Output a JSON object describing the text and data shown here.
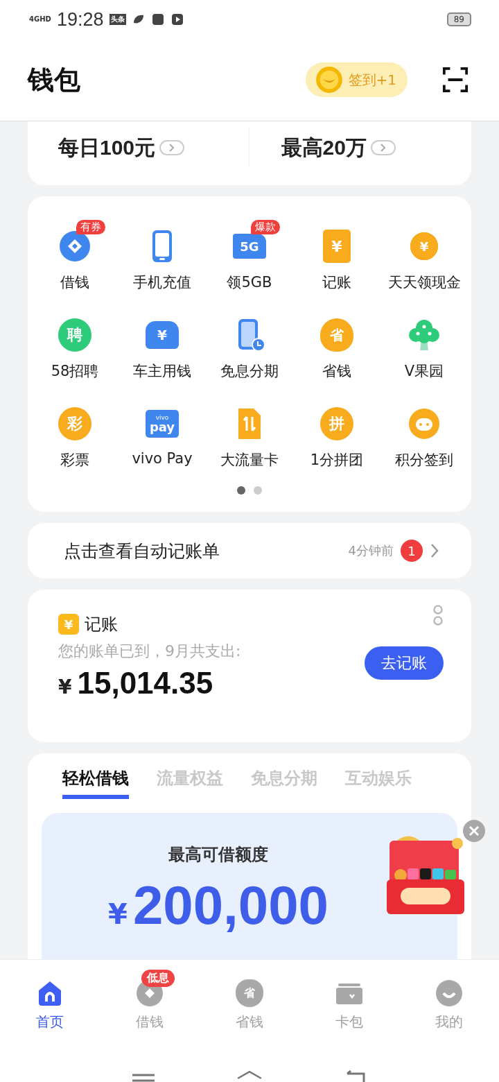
{
  "status_bar": {
    "network": "4GHD",
    "time": "19:28",
    "app_badge": "头条",
    "battery": "89"
  },
  "header": {
    "title": "钱包",
    "checkin": "签到+1"
  },
  "quick_stats": [
    {
      "value": "每日100元"
    },
    {
      "value": "最高20万"
    }
  ],
  "services": [
    {
      "label": "借钱",
      "kind": "coin-diamond",
      "color": "#3f86ee",
      "badge": "有券"
    },
    {
      "label": "手机充值",
      "kind": "phone",
      "color": "#3f86ee"
    },
    {
      "label": "领5GB",
      "kind": "sim",
      "color": "#3f86ee",
      "glyph": "5G",
      "badge": "爆款"
    },
    {
      "label": "记账",
      "kind": "book",
      "color": "#f8ab1c",
      "glyph": "¥"
    },
    {
      "label": "天天领现金",
      "kind": "ring",
      "color": "#f8ab1c",
      "glyph": "¥"
    },
    {
      "label": "58招聘",
      "kind": "circle",
      "color": "#2ecc7a",
      "glyph": "聘"
    },
    {
      "label": "车主用钱",
      "kind": "car",
      "color": "#3f86ee",
      "glyph": "¥"
    },
    {
      "label": "免息分期",
      "kind": "phone-clock",
      "color": "#3f86ee"
    },
    {
      "label": "省钱",
      "kind": "bag",
      "color": "#f8ab1c",
      "glyph": "省"
    },
    {
      "label": "V果园",
      "kind": "tree",
      "color": "#2ecc7a"
    },
    {
      "label": "彩票",
      "kind": "circle",
      "color": "#f8ab1c",
      "glyph": "彩"
    },
    {
      "label": "vivo Pay",
      "kind": "pay",
      "color": "#3f86ee",
      "glyph": "pay",
      "glyph_small": "vivo"
    },
    {
      "label": "大流量卡",
      "kind": "card-arrows",
      "color": "#f8ab1c"
    },
    {
      "label": "1分拼团",
      "kind": "circle",
      "color": "#f8ab1c",
      "glyph": "拼"
    },
    {
      "label": "积分签到",
      "kind": "face",
      "color": "#f8ab1c"
    }
  ],
  "pager": [
    {
      "selected": true
    },
    {
      "selected": false
    }
  ],
  "auto_bill": {
    "title": "点击查看自动记账单",
    "time": "4分钟前",
    "count": "1"
  },
  "ledger": {
    "icon_glyph": "¥",
    "title": "记账",
    "message": "您的账单已到，9月共支出:",
    "currency": "¥",
    "amount": "15,014.35",
    "button": "去记账"
  },
  "tabs": [
    {
      "label": "轻松借钱",
      "selected": true
    },
    {
      "label": "流量权益",
      "selected": false
    },
    {
      "label": "免息分期",
      "selected": false
    },
    {
      "label": "互动娱乐",
      "selected": false
    }
  ],
  "loan": {
    "title": "最高可借额度",
    "currency": "¥",
    "amount": "200,000"
  },
  "nav": [
    {
      "label": "首页",
      "kind": "home",
      "selected": true
    },
    {
      "label": "借钱",
      "kind": "coin-diamond",
      "selected": false,
      "badge": "低息"
    },
    {
      "label": "省钱",
      "kind": "bag",
      "selected": false,
      "glyph": "省"
    },
    {
      "label": "卡包",
      "kind": "wallet",
      "selected": false
    },
    {
      "label": "我的",
      "kind": "face",
      "selected": false
    }
  ]
}
